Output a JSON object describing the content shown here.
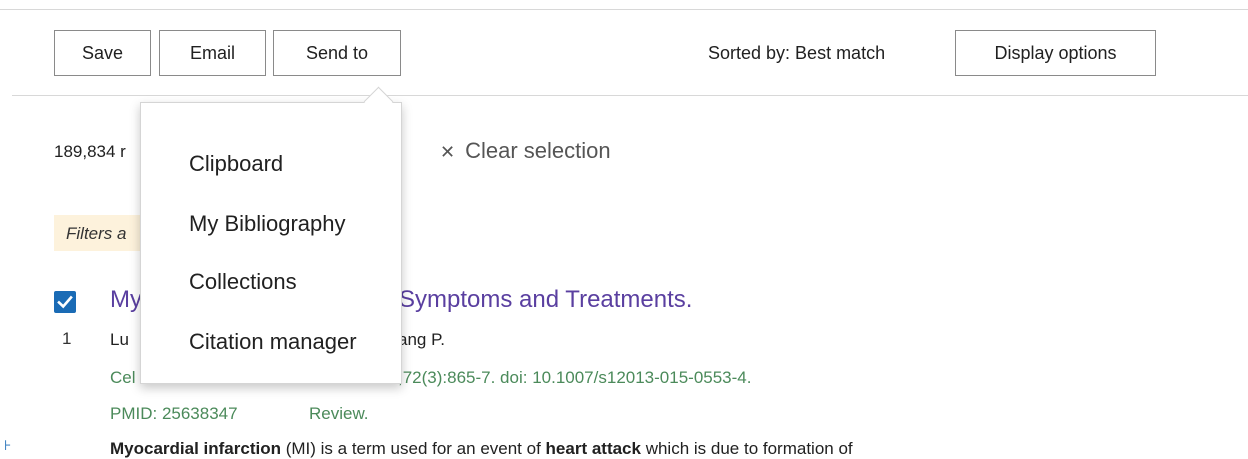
{
  "toolbar": {
    "save_label": "Save",
    "email_label": "Email",
    "send_to_label": "Send to",
    "sorted_by": "Sorted by: Best match",
    "display_options_label": "Display options"
  },
  "send_to_menu": {
    "items": [
      "Clipboard",
      "My Bibliography",
      "Collections",
      "Citation manager"
    ]
  },
  "results": {
    "count_text": "189,834 r",
    "clear_selection": "Clear selection",
    "filters_text": "Filters a"
  },
  "result": {
    "number": "1",
    "title_left": "My",
    "title_right": "Symptoms and Treatments.",
    "authors_left": "Lu",
    "authors_right": "ang P.",
    "citation_left": "Cel",
    "citation_right": ";72(3):865-7. doi: 10.1007/s12013-015-0553-4.",
    "pmid": "PMID: 25638347",
    "review": "Review.",
    "abstract_b1": "Myocardial infarction",
    "abstract_t1": " (MI) is a term used for an event of ",
    "abstract_b2": "heart attack",
    "abstract_t2": " which is due to formation of"
  },
  "colors": {
    "link_purple": "#5a3fa0",
    "citation_green": "#4b8a5a",
    "checkbox_blue": "#1a6bb5",
    "filter_bg": "#fdf2dc"
  }
}
